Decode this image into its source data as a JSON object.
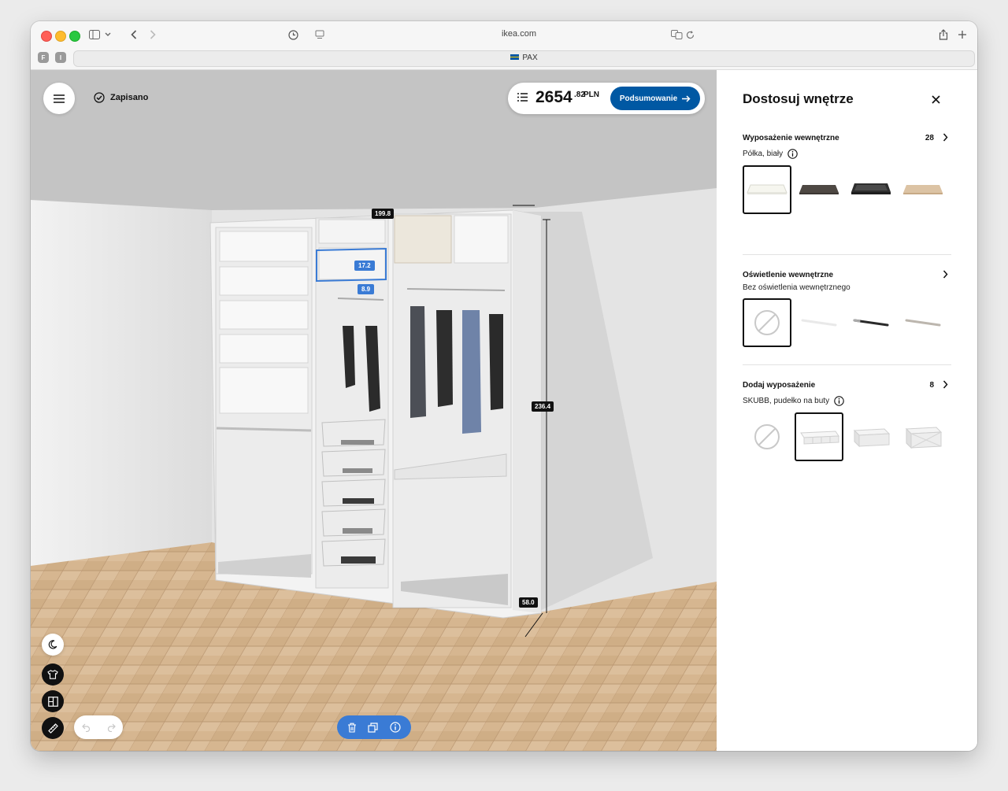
{
  "browser": {
    "url": "ikea.com",
    "tab_title": "PAX",
    "tab_favicon": "ikea-flag-icon",
    "pinned_tabs": [
      "F",
      "I"
    ],
    "icons": [
      "sidebar-icon",
      "chevron-down-icon",
      "back-icon",
      "forward-icon",
      "history-icon",
      "reader-icon",
      "translate-icon",
      "reload-icon",
      "share-icon",
      "plus-icon"
    ]
  },
  "planner": {
    "menu_icon": "hamburger-icon",
    "saved_label": "Zapisano",
    "price": {
      "integer": "2654",
      "decimal": ".82",
      "currency": "PLN"
    },
    "summary_button": "Podsumowanie",
    "dimensions": {
      "width": "199.8",
      "height": "236.4",
      "depth": "58.0",
      "selected_height": "17.2",
      "selected_depth": "8.9"
    },
    "tools": [
      "moon-icon",
      "tshirt-icon",
      "doors-icon",
      "ruler-icon"
    ],
    "undo_icons": [
      "undo-icon",
      "redo-icon"
    ],
    "actions": [
      "trash-icon",
      "duplicate-icon",
      "info-icon"
    ]
  },
  "panel": {
    "title": "Dostosuj wnętrze",
    "sections": [
      {
        "title": "Wyposażenie wewnętrzne",
        "count": "28",
        "subtitle": "Półka, biały",
        "has_info": true,
        "selected_index": 0,
        "tiles": [
          "white-shelf",
          "dark-brown-shelf",
          "black-brown-shelf-tray",
          "oak-shelf"
        ]
      },
      {
        "title": "Oświetlenie wewnętrzne",
        "count": "",
        "subtitle": "Bez oświetlenia wewnętrznego",
        "has_info": false,
        "selected_index": 0,
        "tiles": [
          "none-icon",
          "white-led-strip",
          "black-led-strip",
          "grey-led-strip"
        ]
      },
      {
        "title": "Dodaj wyposażenie",
        "count": "8",
        "subtitle": "SKUBB, pudełko na buty",
        "has_info": true,
        "selected_index": 1,
        "tiles": [
          "none-icon",
          "skubb-shoe-box",
          "white-box",
          "white-storage-case"
        ]
      }
    ]
  },
  "colors": {
    "ikea_blue": "#0058a3",
    "selection_blue": "#3a7bd5"
  }
}
